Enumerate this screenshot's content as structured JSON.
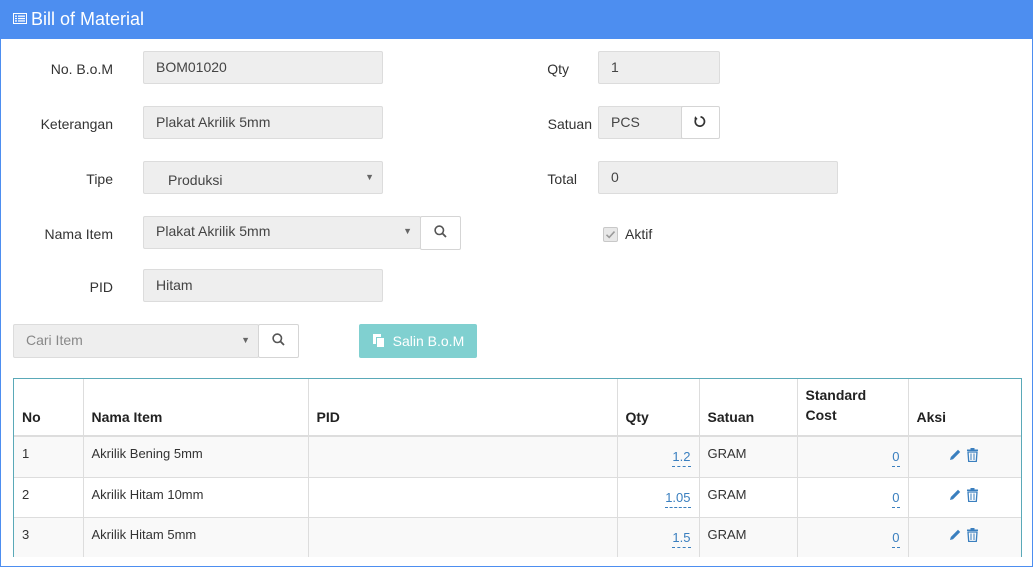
{
  "header": {
    "title": "Bill of Material",
    "icon": "list-alt-icon",
    "color": "#4d8ef0"
  },
  "form": {
    "no_bom": {
      "label": "No. B.o.M",
      "value": "BOM01020"
    },
    "keterangan": {
      "label": "Keterangan",
      "value": "Plakat Akrilik 5mm"
    },
    "tipe": {
      "label": "Tipe",
      "value": "Produksi"
    },
    "nama_item": {
      "label": "Nama Item",
      "value": "Plakat Akrilik 5mm"
    },
    "pid": {
      "label": "PID",
      "value": "Hitam"
    },
    "qty": {
      "label": "Qty",
      "value": "1"
    },
    "satuan": {
      "label": "Satuan",
      "value": "PCS"
    },
    "total": {
      "label": "Total",
      "value": "0"
    },
    "aktif": {
      "label": "Aktif",
      "checked": true
    }
  },
  "toolbar": {
    "cari_item_placeholder": "Cari Item",
    "salin_label": "Salin B.o.M"
  },
  "table": {
    "headers": [
      "No",
      "Nama Item",
      "PID",
      "Qty",
      "Satuan",
      "Standard Cost",
      "Aksi"
    ],
    "rows": [
      {
        "no": "1",
        "nama": "Akrilik Bening 5mm",
        "pid": "",
        "qty": "1.2",
        "satuan": "GRAM",
        "cost": "0"
      },
      {
        "no": "2",
        "nama": "Akrilik Hitam 10mm",
        "pid": "",
        "qty": "1.05",
        "satuan": "GRAM",
        "cost": "0"
      },
      {
        "no": "3",
        "nama": "Akrilik Hitam 5mm",
        "pid": "",
        "qty": "1.5",
        "satuan": "GRAM",
        "cost": "0"
      }
    ]
  }
}
